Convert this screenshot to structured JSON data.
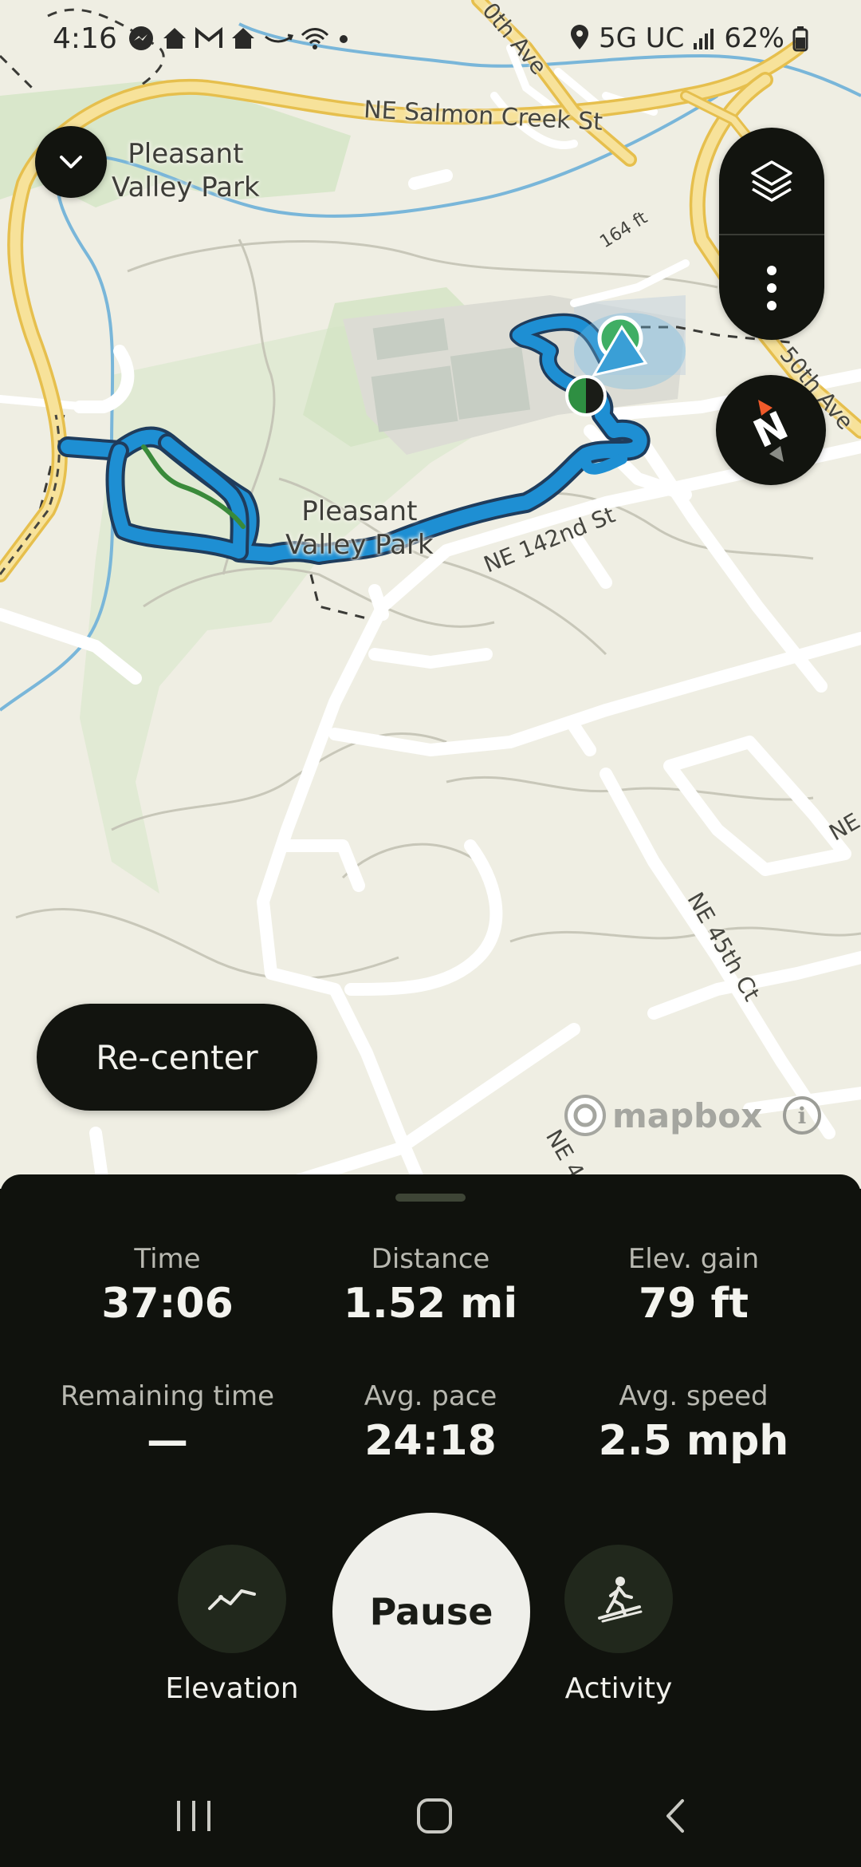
{
  "status_bar": {
    "time": "4:16",
    "network": "5G UC",
    "battery": "62%",
    "icons": [
      "messenger-icon",
      "home-icon",
      "gmail-icon",
      "home-icon",
      "amazon-icon",
      "wifi-icon",
      "dot-icon",
      "location-icon",
      "signal-icon",
      "battery-icon"
    ]
  },
  "map": {
    "park_labels": [
      "Pleasant\nValley Park",
      "Pleasant\nValley Park"
    ],
    "street_labels": {
      "salmon_creek": "NE Salmon Creek St",
      "ave_top": "0th Ave",
      "ft_164": "164 ft",
      "ave_50th": "50th Ave",
      "st_142nd": "NE 142nd St",
      "ct_45th": "NE 45th Ct",
      "ne_right": "NE",
      "ne_bottom": "NE 4"
    },
    "mapbox_text": "mapbox",
    "info_glyph": "i",
    "colors": {
      "track": "#1e8fd3",
      "track_outline": "#1f3c5c",
      "road_major": "#f3d77d",
      "water": "#7bb9dc",
      "park": "#d7e6c8"
    }
  },
  "controls": {
    "recenter_label": "Re-center",
    "compass_letter": "N"
  },
  "stats": {
    "time_label": "Time",
    "time_value": "37:06",
    "distance_label": "Distance",
    "distance_value": "1.52 mi",
    "elev_label": "Elev. gain",
    "elev_value": "79 ft",
    "remaining_label": "Remaining time",
    "remaining_value": "—",
    "pace_label": "Avg. pace",
    "pace_value": "24:18",
    "speed_label": "Avg. speed",
    "speed_value": "2.5 mph"
  },
  "actions": {
    "elevation_label": "Elevation",
    "pause_label": "Pause",
    "activity_label": "Activity"
  }
}
